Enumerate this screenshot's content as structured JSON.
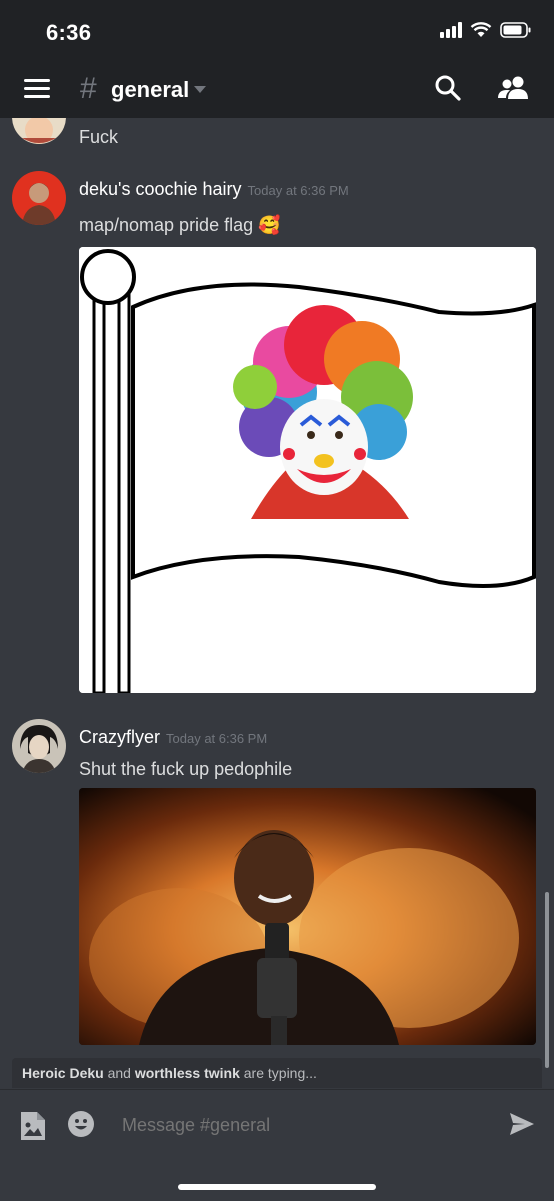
{
  "status_bar": {
    "time": "6:36"
  },
  "header": {
    "channel_hash": "#",
    "channel_name": "general"
  },
  "messages": [
    {
      "continuation_text": "Fuck"
    },
    {
      "username": "deku's coochie hairy",
      "timestamp": "Today at 6:36 PM",
      "text": "map/nomap pride flag 🥰",
      "attachment": "flag-image"
    },
    {
      "username": "Crazyflyer",
      "timestamp": "Today at 6:36 PM",
      "text": "Shut the fuck up pedophile",
      "attachment": "fire-image"
    }
  ],
  "typing": {
    "user1": "Heroic Deku",
    "and": "and",
    "user2": "worthless twink",
    "suffix": "are typing..."
  },
  "composer": {
    "placeholder": "Message #general"
  },
  "colors": {
    "background": "#36393f",
    "header": "#202225",
    "username": "#ffffff",
    "timestamp": "#72767d"
  }
}
